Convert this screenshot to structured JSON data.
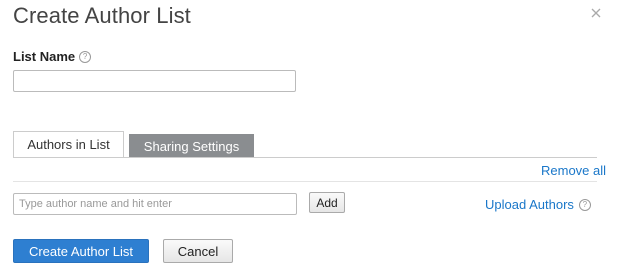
{
  "dialog": {
    "title": "Create Author List",
    "close_icon": "close-icon"
  },
  "list_name": {
    "label": "List Name",
    "help_icon": "help-icon",
    "value": "",
    "placeholder": ""
  },
  "tabs": [
    {
      "label": "Authors in List",
      "active": true
    },
    {
      "label": "Sharing Settings",
      "active": false
    }
  ],
  "authors": {
    "remove_all": "Remove all",
    "input_placeholder": "Type author name and hit enter",
    "input_value": "",
    "add_label": "Add",
    "upload_label": "Upload Authors",
    "upload_help_icon": "help-icon"
  },
  "footer": {
    "create_label": "Create Author List",
    "cancel_label": "Cancel"
  },
  "colors": {
    "primary": "#2e7fd1",
    "link": "#1a77c9",
    "inactive_tab": "#8a8d90"
  }
}
